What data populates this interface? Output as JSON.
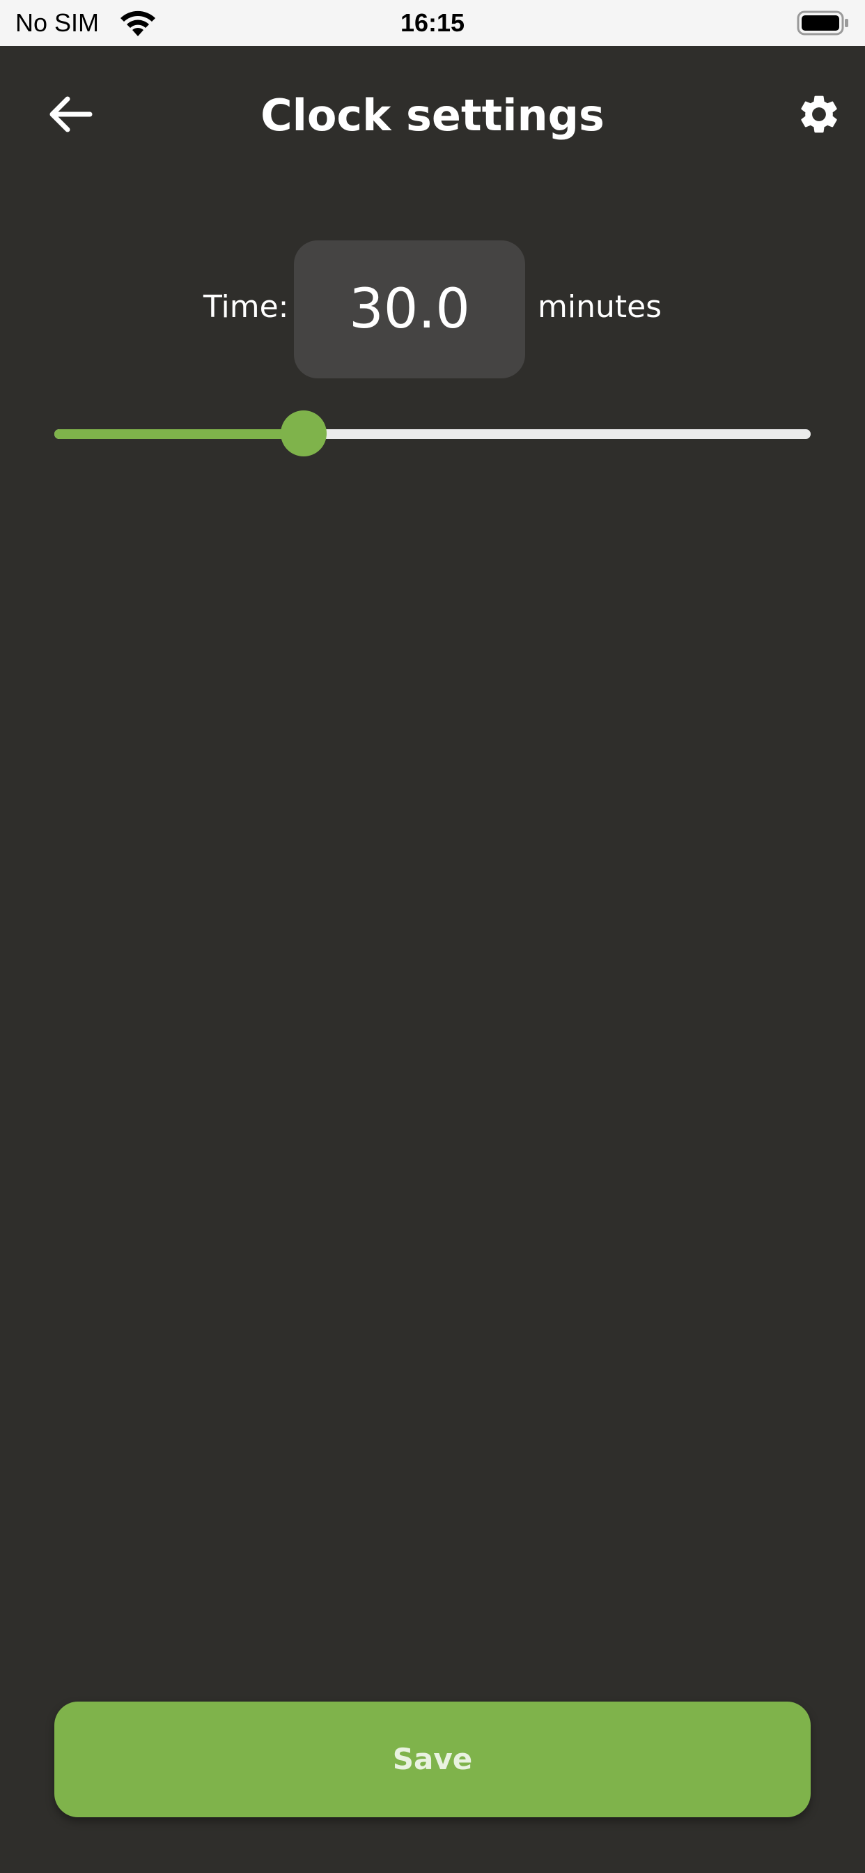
{
  "status_bar": {
    "carrier": "No SIM",
    "time": "16:15",
    "wifi_icon": "wifi-icon",
    "battery_icon": "battery-icon"
  },
  "header": {
    "title": "Clock settings",
    "back_icon": "arrow-left-icon",
    "settings_icon": "gear-icon"
  },
  "time_setting": {
    "label": "Time:",
    "value": "30.0",
    "unit": "minutes"
  },
  "slider": {
    "fraction": 0.33
  },
  "save_button": {
    "label": "Save"
  },
  "colors": {
    "background": "#2f2e2b",
    "accent": "#7fb34b",
    "input_bg": "#454443",
    "track": "#ebebeb"
  }
}
